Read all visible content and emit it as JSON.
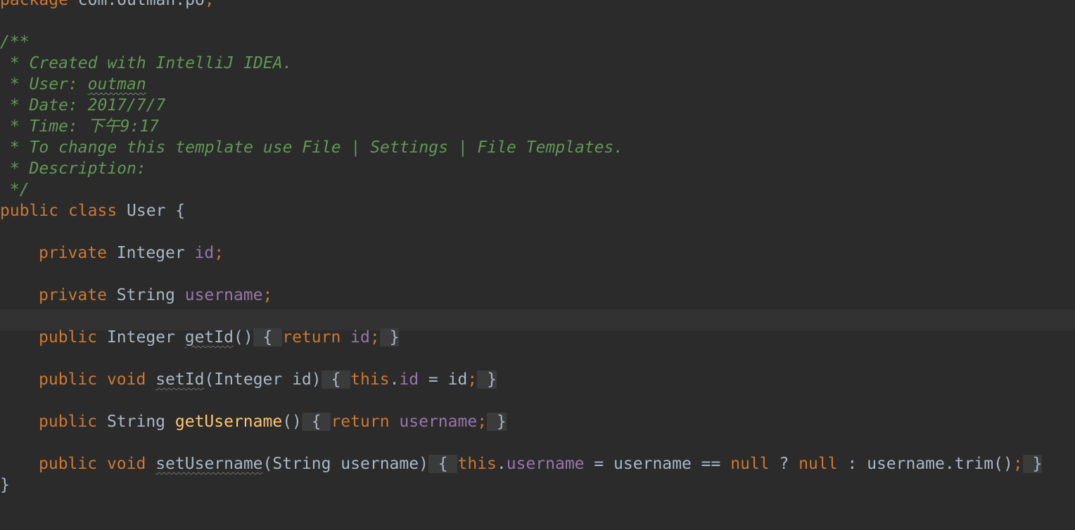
{
  "editor": {
    "package_keyword": "package",
    "package_name": " com.outman.po",
    "semicolon": ";",
    "comment": {
      "open": "/**",
      "created": " * Created with IntelliJ IDEA.",
      "user_label": " * User: ",
      "user_value": "outman",
      "date": " * Date: 2017/7/7",
      "time": " * Time: 下午9:17",
      "template": " * To change this template use File | Settings | File Templates.",
      "description": " * Description:",
      "close": " */"
    },
    "class_decl": {
      "public": "public",
      "class_kw": " class",
      "name": " User",
      "open_brace": " {"
    },
    "fields": [
      {
        "modifier": "private",
        "type": " Integer ",
        "name": "id",
        "semi": ";"
      },
      {
        "modifier": "private",
        "type": " String ",
        "name": "username",
        "semi": ";"
      }
    ],
    "methods": {
      "getId": {
        "modifier": "public",
        "ret": " Integer ",
        "name": "getId",
        "params": "()",
        "fold_open": " { ",
        "return_kw": "return",
        "space": " ",
        "field": "id",
        "semi": ";",
        "fold_close": " }"
      },
      "setId": {
        "modifier": "public",
        "void_kw": " void",
        "space": " ",
        "name": "setId",
        "params": "(Integer id)",
        "fold_open": " { ",
        "this_kw": "this",
        "dot": ".",
        "field": "id",
        "assign": " = id",
        "semi": ";",
        "fold_close": " }"
      },
      "getUsername": {
        "modifier": "public",
        "ret": " String ",
        "name": "getUsername",
        "params": "()",
        "fold_open": " { ",
        "return_kw": "return",
        "space": " ",
        "field": "username",
        "semi": ";",
        "fold_close": " }"
      },
      "setUsername": {
        "modifier": "public",
        "void_kw": " void",
        "space": " ",
        "name": "setUsername",
        "params": "(String username)",
        "fold_open": " { ",
        "this_kw": "this",
        "dot": ".",
        "field": "username",
        "expr1": " = username == ",
        "null1": "null",
        "q": " ? ",
        "null2": "null",
        "expr2": " : username.trim()",
        "semi": ";",
        "fold_close": " }"
      }
    },
    "closing_brace": "}"
  }
}
